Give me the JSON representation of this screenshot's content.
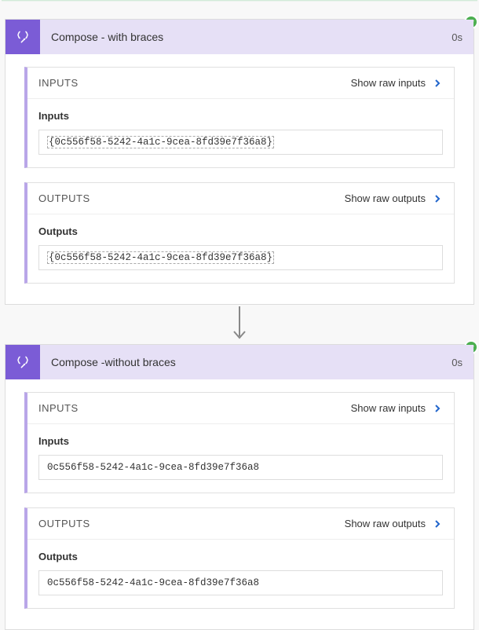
{
  "steps": [
    {
      "title": "Compose - with braces",
      "duration": "0s",
      "inputs": {
        "sectionTitle": "INPUTS",
        "showRaw": "Show raw inputs",
        "label": "Inputs",
        "value": "{0c556f58-5242-4a1c-9cea-8fd39e7f36a8}",
        "braced": true
      },
      "outputs": {
        "sectionTitle": "OUTPUTS",
        "showRaw": "Show raw outputs",
        "label": "Outputs",
        "value": "{0c556f58-5242-4a1c-9cea-8fd39e7f36a8}",
        "braced": true
      }
    },
    {
      "title": "Compose -without braces",
      "duration": "0s",
      "inputs": {
        "sectionTitle": "INPUTS",
        "showRaw": "Show raw inputs",
        "label": "Inputs",
        "value": "0c556f58-5242-4a1c-9cea-8fd39e7f36a8",
        "braced": false
      },
      "outputs": {
        "sectionTitle": "OUTPUTS",
        "showRaw": "Show raw outputs",
        "label": "Outputs",
        "value": "0c556f58-5242-4a1c-9cea-8fd39e7f36a8",
        "braced": false
      }
    }
  ]
}
